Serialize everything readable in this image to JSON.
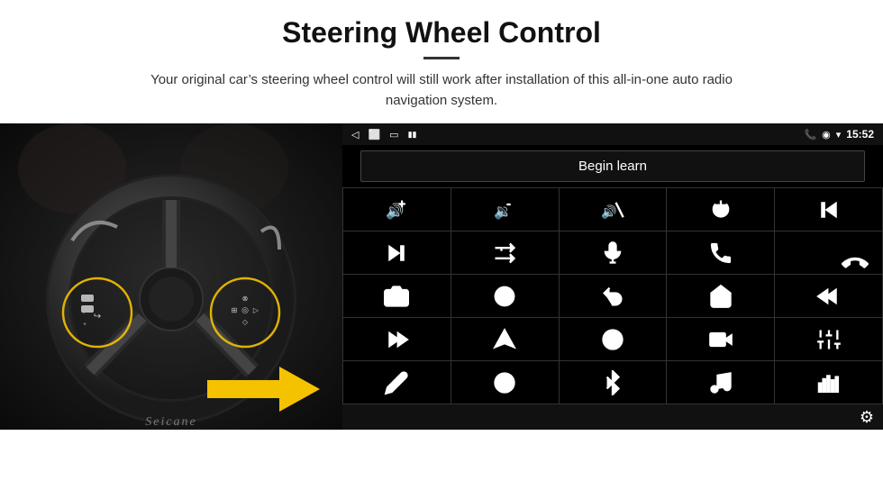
{
  "page": {
    "title": "Steering Wheel Control",
    "subtitle": "Your original car’s steering wheel control will still work after installation of this all-in-one auto radio navigation system.",
    "status_time": "15:52",
    "begin_learn_label": "Begin learn",
    "seicane_label": "Seicane",
    "settings_icon": "⚙",
    "icons": [
      {
        "name": "vol-up",
        "symbol": "vol+"
      },
      {
        "name": "vol-down",
        "symbol": "vol-"
      },
      {
        "name": "mute",
        "symbol": "mute"
      },
      {
        "name": "power",
        "symbol": "pwr"
      },
      {
        "name": "prev-track",
        "symbol": "prev"
      },
      {
        "name": "next",
        "symbol": "next"
      },
      {
        "name": "shuffle",
        "symbol": "shuf"
      },
      {
        "name": "mic",
        "symbol": "mic"
      },
      {
        "name": "phone",
        "symbol": "phone"
      },
      {
        "name": "hang-up",
        "symbol": "hangup"
      },
      {
        "name": "camera",
        "symbol": "cam"
      },
      {
        "name": "360view",
        "symbol": "360"
      },
      {
        "name": "back",
        "symbol": "back"
      },
      {
        "name": "home",
        "symbol": "home"
      },
      {
        "name": "skip-back",
        "symbol": "skipb"
      },
      {
        "name": "fast-forward",
        "symbol": "ff"
      },
      {
        "name": "nav",
        "symbol": "nav"
      },
      {
        "name": "eq",
        "symbol": "eq"
      },
      {
        "name": "media",
        "symbol": "media"
      },
      {
        "name": "settings2",
        "symbol": "set2"
      },
      {
        "name": "pen",
        "symbol": "pen"
      },
      {
        "name": "radio",
        "symbol": "radio"
      },
      {
        "name": "bluetooth",
        "symbol": "bt"
      },
      {
        "name": "music",
        "symbol": "mus"
      },
      {
        "name": "spectrum",
        "symbol": "spec"
      }
    ]
  }
}
